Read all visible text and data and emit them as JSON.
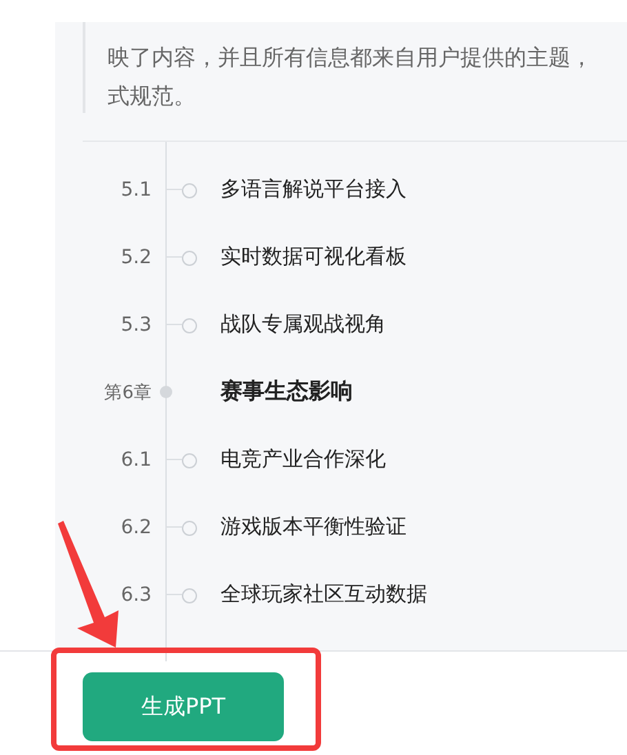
{
  "note": {
    "lines": [
      "映了内容，并且所有信息都来自用户提供的主题，",
      "式规范。"
    ]
  },
  "outline": [
    {
      "kind": "section",
      "number": "5.1",
      "title": "多语言解说平台接入"
    },
    {
      "kind": "section",
      "number": "5.2",
      "title": "实时数据可视化看板"
    },
    {
      "kind": "section",
      "number": "5.3",
      "title": "战队专属观战视角"
    },
    {
      "kind": "chapter",
      "number": "第6章",
      "title": "赛事生态影响"
    },
    {
      "kind": "section",
      "number": "6.1",
      "title": "电竞产业合作深化"
    },
    {
      "kind": "section",
      "number": "6.2",
      "title": "游戏版本平衡性验证"
    },
    {
      "kind": "section",
      "number": "6.3",
      "title": "全球玩家社区互动数据"
    }
  ],
  "action": {
    "label": "生成PPT"
  }
}
